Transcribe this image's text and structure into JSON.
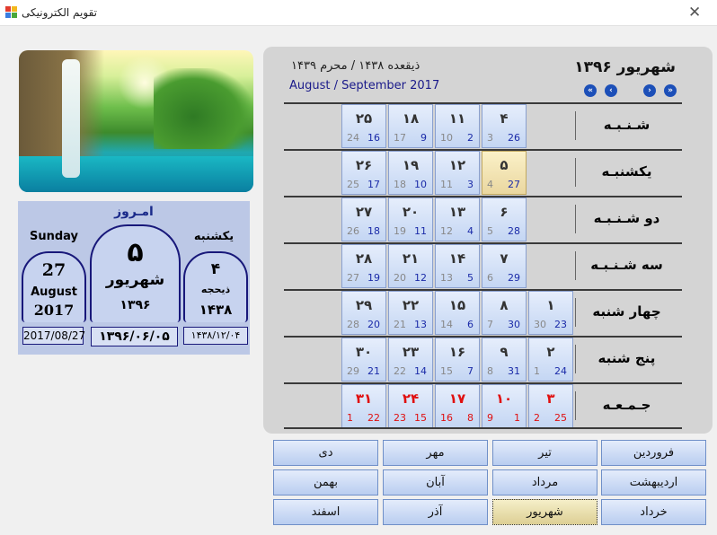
{
  "window": {
    "title": "تقویم الکترونیکی"
  },
  "today_panel": {
    "title": "امـروز",
    "gregorian": {
      "weekday": "Sunday",
      "day": "27",
      "month": "August",
      "year": "2017",
      "date": "2017/08/27"
    },
    "persian": {
      "day": "۵",
      "month": "شهریور",
      "year": "۱۳۹۶",
      "date": "۱۳۹۶/۰۶/۰۵"
    },
    "hijri": {
      "weekday": "یکشنبه",
      "day": "۴",
      "month": "ذیحجه",
      "year": "۱۴۳۸",
      "date": "۱۴۳۸/۱۲/۰۴"
    }
  },
  "calendar": {
    "month_title": "شهریور ۱۳۹۶",
    "hijri_range": "ذیقعده ۱۴۳۸ / محرم ۱۴۳۹",
    "gregorian_range": "August / September 2017",
    "nav": {
      "first": "«",
      "prev": "‹",
      "next": "›",
      "last": "»"
    },
    "weekdays": [
      "شـنـبـه",
      "یکشنبـه",
      "دو شـنـبـه",
      "سه شـنـبـه",
      "چهار شنبه",
      "پنج شنبه",
      "جـمـعـه"
    ],
    "columns": [
      [
        null,
        null,
        null,
        null,
        {
          "p": "۱",
          "h": "30",
          "g": "23"
        },
        {
          "p": "۲",
          "h": "1",
          "g": "24"
        },
        {
          "p": "۳",
          "h": "2",
          "g": "25"
        }
      ],
      [
        {
          "p": "۴",
          "h": "3",
          "g": "26"
        },
        {
          "p": "۵",
          "h": "4",
          "g": "27",
          "today": true
        },
        {
          "p": "۶",
          "h": "5",
          "g": "28"
        },
        {
          "p": "۷",
          "h": "6",
          "g": "29"
        },
        {
          "p": "۸",
          "h": "7",
          "g": "30"
        },
        {
          "p": "۹",
          "h": "8",
          "g": "31"
        },
        {
          "p": "۱۰",
          "h": "9",
          "g": "1"
        }
      ],
      [
        {
          "p": "۱۱",
          "h": "10",
          "g": "2"
        },
        {
          "p": "۱۲",
          "h": "11",
          "g": "3"
        },
        {
          "p": "۱۳",
          "h": "12",
          "g": "4"
        },
        {
          "p": "۱۴",
          "h": "13",
          "g": "5"
        },
        {
          "p": "۱۵",
          "h": "14",
          "g": "6"
        },
        {
          "p": "۱۶",
          "h": "15",
          "g": "7"
        },
        {
          "p": "۱۷",
          "h": "16",
          "g": "8"
        }
      ],
      [
        {
          "p": "۱۸",
          "h": "17",
          "g": "9"
        },
        {
          "p": "۱۹",
          "h": "18",
          "g": "10"
        },
        {
          "p": "۲۰",
          "h": "19",
          "g": "11"
        },
        {
          "p": "۲۱",
          "h": "20",
          "g": "12"
        },
        {
          "p": "۲۲",
          "h": "21",
          "g": "13"
        },
        {
          "p": "۲۳",
          "h": "22",
          "g": "14"
        },
        {
          "p": "۲۴",
          "h": "23",
          "g": "15"
        }
      ],
      [
        {
          "p": "۲۵",
          "h": "24",
          "g": "16"
        },
        {
          "p": "۲۶",
          "h": "25",
          "g": "17"
        },
        {
          "p": "۲۷",
          "h": "26",
          "g": "18"
        },
        {
          "p": "۲۸",
          "h": "27",
          "g": "19"
        },
        {
          "p": "۲۹",
          "h": "28",
          "g": "20"
        },
        {
          "p": "۳۰",
          "h": "29",
          "g": "21"
        },
        {
          "p": "۳۱",
          "h": "1",
          "g": "22"
        }
      ]
    ]
  },
  "months": [
    {
      "label": "فروردین"
    },
    {
      "label": "تیر"
    },
    {
      "label": "مهر"
    },
    {
      "label": "دی"
    },
    {
      "label": "اردیبهشت"
    },
    {
      "label": "مرداد"
    },
    {
      "label": "آبان"
    },
    {
      "label": "بهمن"
    },
    {
      "label": "خرداد"
    },
    {
      "label": "شهریور",
      "selected": true
    },
    {
      "label": "آذر"
    },
    {
      "label": "اسفند"
    }
  ],
  "colors": {
    "accent": "#1a2a8a",
    "friday": "#e01010",
    "today_cell": "#ead7a0"
  }
}
